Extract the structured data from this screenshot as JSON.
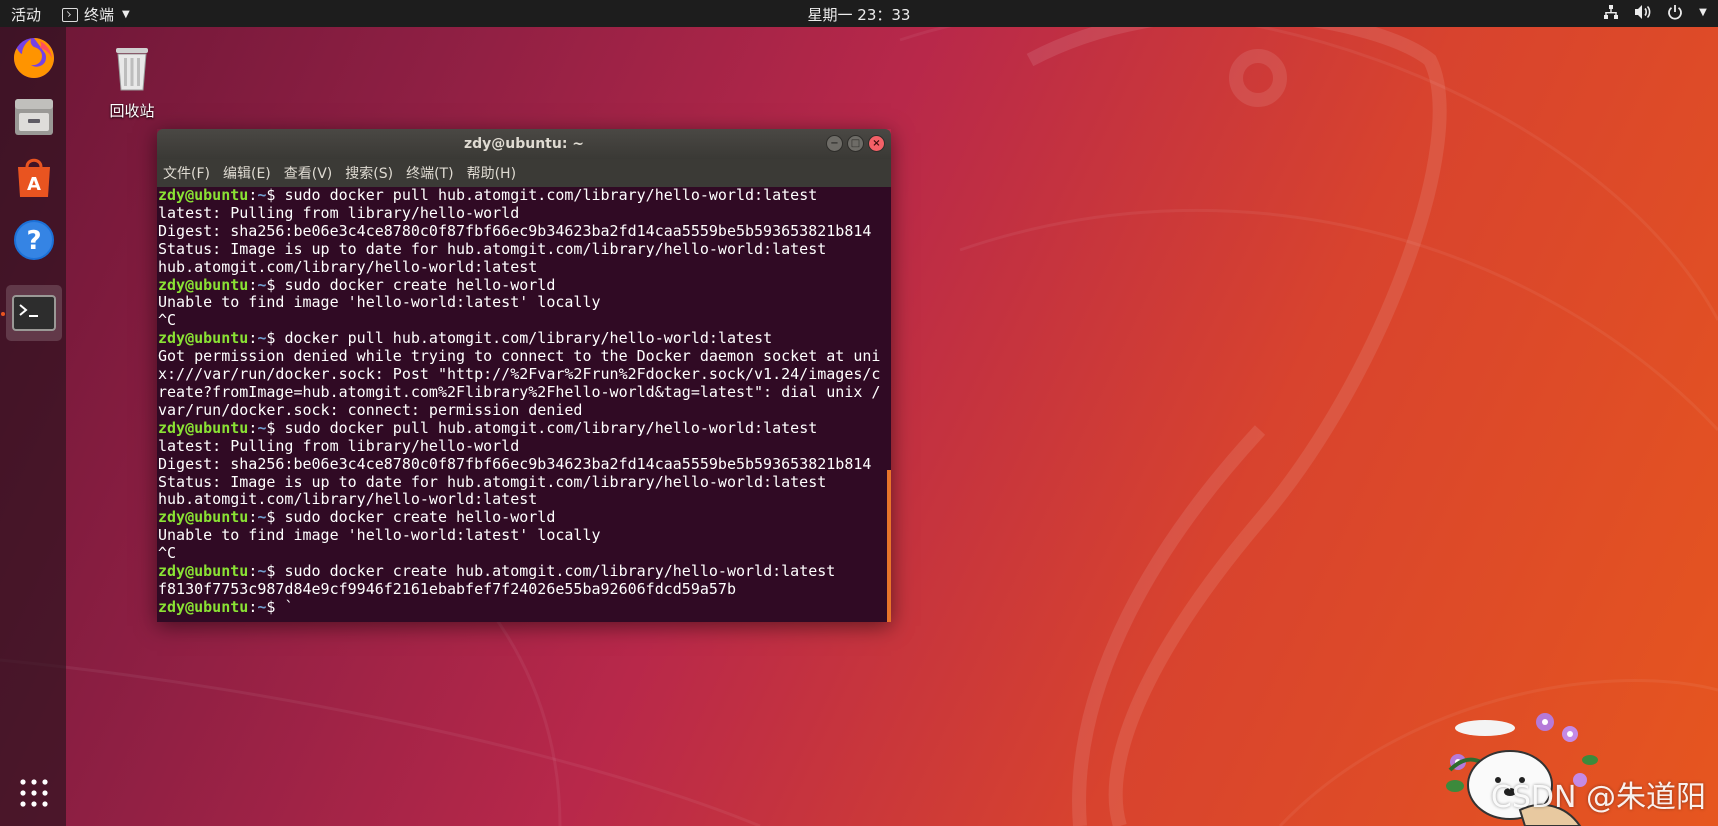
{
  "topbar": {
    "activities": "活动",
    "app_menu": "终端",
    "clock": "星期一 23：33",
    "tray_icons": [
      "network-icon",
      "volume-icon",
      "power-icon"
    ]
  },
  "dock": {
    "items": [
      "firefox-icon",
      "files-icon",
      "software-center-icon",
      "help-icon",
      "terminal-icon"
    ],
    "active": "terminal-icon",
    "show_apps": "app-grid-icon"
  },
  "desktop": {
    "trash_label": "回收站"
  },
  "terminal": {
    "title": "zdy@ubuntu: ~",
    "menu": [
      "文件(F)",
      "编辑(E)",
      "查看(V)",
      "搜索(S)",
      "终端(T)",
      "帮助(H)"
    ],
    "prompt_user": "zdy@ubuntu",
    "prompt_path": "~",
    "lines": [
      {
        "type": "cmd",
        "text": "sudo docker pull hub.atomgit.com/library/hello-world:latest"
      },
      {
        "type": "out",
        "text": "latest: Pulling from library/hello-world"
      },
      {
        "type": "out",
        "text": "Digest: sha256:be06e3c4ce8780c0f87fbf66ec9b34623ba2fd14caa5559be5b593653821b814"
      },
      {
        "type": "out",
        "text": "Status: Image is up to date for hub.atomgit.com/library/hello-world:latest"
      },
      {
        "type": "out",
        "text": "hub.atomgit.com/library/hello-world:latest"
      },
      {
        "type": "cmd",
        "text": "sudo docker create hello-world"
      },
      {
        "type": "out",
        "text": "Unable to find image 'hello-world:latest' locally"
      },
      {
        "type": "out",
        "text": "^C"
      },
      {
        "type": "cmd",
        "text": "docker pull hub.atomgit.com/library/hello-world:latest"
      },
      {
        "type": "out",
        "text": "Got permission denied while trying to connect to the Docker daemon socket at uni"
      },
      {
        "type": "out",
        "text": "x:///var/run/docker.sock: Post \"http://%2Fvar%2Frun%2Fdocker.sock/v1.24/images/c"
      },
      {
        "type": "out",
        "text": "reate?fromImage=hub.atomgit.com%2Flibrary%2Fhello-world&tag=latest\": dial unix /"
      },
      {
        "type": "out",
        "text": "var/run/docker.sock: connect: permission denied"
      },
      {
        "type": "cmd",
        "text": "sudo docker pull hub.atomgit.com/library/hello-world:latest"
      },
      {
        "type": "out",
        "text": "latest: Pulling from library/hello-world"
      },
      {
        "type": "out",
        "text": "Digest: sha256:be06e3c4ce8780c0f87fbf66ec9b34623ba2fd14caa5559be5b593653821b814"
      },
      {
        "type": "out",
        "text": "Status: Image is up to date for hub.atomgit.com/library/hello-world:latest"
      },
      {
        "type": "out",
        "text": "hub.atomgit.com/library/hello-world:latest"
      },
      {
        "type": "cmd",
        "text": "sudo docker create hello-world"
      },
      {
        "type": "out",
        "text": "Unable to find image 'hello-world:latest' locally"
      },
      {
        "type": "out",
        "text": "^C"
      },
      {
        "type": "cmd",
        "text": "sudo docker create hub.atomgit.com/library/hello-world:latest"
      },
      {
        "type": "out",
        "text": "f8130f7753c987d84e9cf9946f2161ebabfef7f24026e55ba92606fdcd59a57b"
      },
      {
        "type": "cmd",
        "text": "`"
      }
    ]
  },
  "watermark": "CSDN @朱道阳",
  "colors": {
    "prompt_user": "#8ae234",
    "prompt_path": "#729fcf",
    "terminal_bg": "#300a24",
    "accent": "#e95420"
  }
}
